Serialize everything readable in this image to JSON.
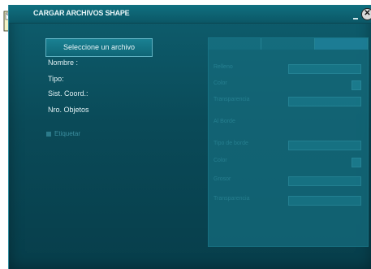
{
  "window": {
    "title": "CARGAR ARCHIVOS SHAPE",
    "close_glyph": "✕"
  },
  "icons": {
    "app": "shapefile-app-icon"
  },
  "main": {
    "select_button": "Seleccione un archivo",
    "info": {
      "nombre": "Nombre :",
      "tipo": "Tipo:",
      "sist_coord": "Sist. Coord.:",
      "nro_objetos": "Nro. Objetos"
    },
    "etiquetar": "Etiquetar"
  },
  "panel": {
    "tabs": [
      "",
      "",
      ""
    ],
    "rows": [
      {
        "label": "Relleno",
        "control": "field"
      },
      {
        "label": "Color",
        "control": "check"
      },
      {
        "label": "Transparencia",
        "control": "field"
      },
      {
        "label": "Al Borde",
        "control": "none"
      },
      {
        "label": "Tipo de borde",
        "control": "field"
      },
      {
        "label": "Color",
        "control": "check"
      },
      {
        "label": "Grosor",
        "control": "field"
      },
      {
        "label": "Transparencia",
        "control": "field"
      }
    ]
  },
  "colors": {
    "window_bg": "#0a4a58",
    "accent": "#1a8193",
    "text": "#e2f1f4"
  }
}
